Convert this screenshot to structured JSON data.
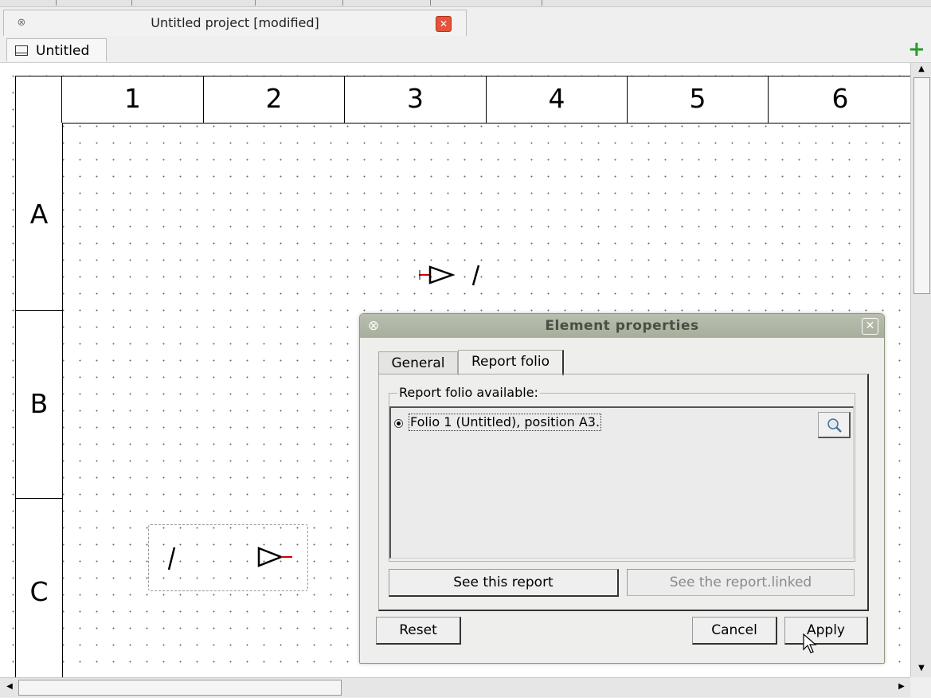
{
  "project": {
    "title": "Untitled project [modified]",
    "close_icon": "close-icon"
  },
  "folio_tabs": [
    {
      "label": "Untitled",
      "icon": "diagram-icon"
    }
  ],
  "add_folio_icon": "plus-icon",
  "diagram": {
    "columns": [
      "1",
      "2",
      "3",
      "4",
      "5",
      "6"
    ],
    "rows": [
      "A",
      "B",
      "C"
    ]
  },
  "dialog": {
    "title": "Element properties",
    "tabs": [
      "General",
      "Report folio"
    ],
    "active_tab": "Report folio",
    "group_label": "Report folio available:",
    "folio_items": [
      {
        "label": "Folio  1 (Untitled), position A3.",
        "selected": true
      }
    ],
    "buttons": {
      "see_report": "See this report",
      "see_linked": "See the report.linked",
      "reset": "Reset",
      "cancel": "Cancel",
      "apply": "Apply"
    }
  },
  "colors": {
    "titlebar": "#a7ae9c",
    "close_red": "#e5533a",
    "add_green": "#2b9a2b",
    "terminal_red": "#d00000"
  }
}
